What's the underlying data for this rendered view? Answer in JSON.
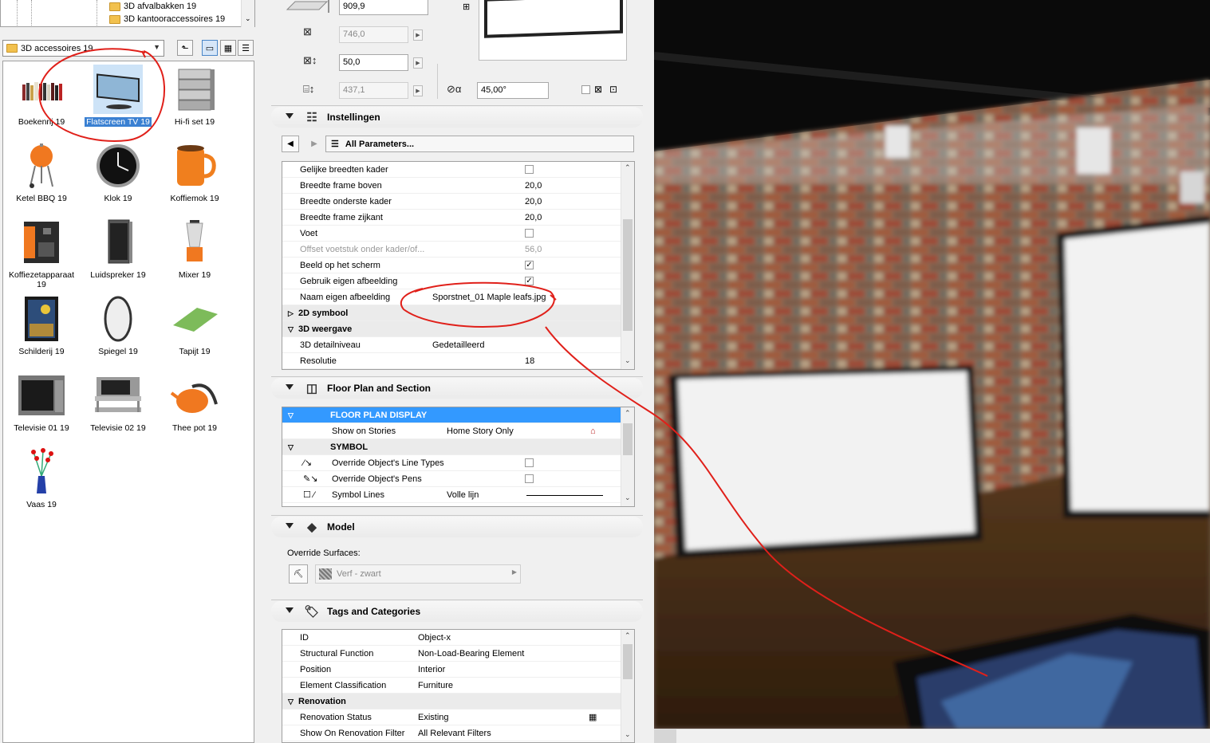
{
  "library": {
    "tree_items": [
      "3D afvalbakken 19",
      "3D kantooraccessoires 19"
    ],
    "current_library": "3D accessoires 19",
    "items": [
      {
        "label": "Boekenrij 19",
        "icon": "bookshelf-icon"
      },
      {
        "label": "Flatscreen TV 19",
        "icon": "flatscreen-tv-icon",
        "selected": true
      },
      {
        "label": "Hi-fi set 19",
        "icon": "hifi-set-icon"
      },
      {
        "label": "Ketel BBQ 19",
        "icon": "bbq-icon"
      },
      {
        "label": "Klok 19",
        "icon": "clock-icon"
      },
      {
        "label": "Koffiemok 19",
        "icon": "mug-icon"
      },
      {
        "label": "Koffiezetapparaat 19",
        "icon": "coffee-machine-icon"
      },
      {
        "label": "Luidspreker 19",
        "icon": "speaker-icon"
      },
      {
        "label": "Mixer 19",
        "icon": "blender-icon"
      },
      {
        "label": "Schilderij 19",
        "icon": "painting-icon"
      },
      {
        "label": "Spiegel 19",
        "icon": "mirror-icon"
      },
      {
        "label": "Tapijt 19",
        "icon": "rug-icon"
      },
      {
        "label": "Televisie 01 19",
        "icon": "crt-tv-icon"
      },
      {
        "label": "Televisie 02 19",
        "icon": "tv-stand-icon"
      },
      {
        "label": "Thee pot 19",
        "icon": "teapot-icon"
      },
      {
        "label": "Vaas 19",
        "icon": "vase-icon"
      }
    ]
  },
  "geometry_fields": {
    "height": "909,9",
    "width": "746,0",
    "depth": "50,0",
    "elevation": "437,1",
    "angle": "45,00°"
  },
  "instellingen": {
    "title": "Instellingen",
    "all_params_label": "All Parameters...",
    "rows": [
      {
        "name": "Gelijke breedten kader",
        "type": "check",
        "checked": false
      },
      {
        "name": "Breedte frame boven",
        "value": "20,0"
      },
      {
        "name": "Breedte onderste kader",
        "value": "20,0"
      },
      {
        "name": "Breedte frame zijkant",
        "value": "20,0"
      },
      {
        "name": "Voet",
        "type": "check",
        "checked": false
      },
      {
        "name": "Offset voetstuk onder kader/of...",
        "value": "56,0",
        "dim": true
      },
      {
        "name": "Beeld op het scherm",
        "type": "check",
        "checked": true
      },
      {
        "name": "Gebruik eigen afbeelding",
        "type": "check",
        "checked": true
      },
      {
        "name": "Naam eigen afbeelding",
        "value": "Sporstnet_01 Maple leafs.jpg",
        "wide": true
      },
      {
        "name": "2D symbool",
        "group": true,
        "open": false
      },
      {
        "name": "3D weergave",
        "group": true,
        "open": true
      },
      {
        "name": "3D detailniveau",
        "value": "Gedetailleerd",
        "wide": true
      },
      {
        "name": "Resolutie",
        "value": "18"
      }
    ]
  },
  "floor_plan": {
    "title": "Floor Plan and Section",
    "rows": [
      {
        "name": "FLOOR PLAN DISPLAY",
        "highlight": true
      },
      {
        "name": "Show on Stories",
        "value": "Home Story Only"
      },
      {
        "name": "SYMBOL",
        "group": true
      },
      {
        "name": "Override Object's Line Types",
        "type": "check"
      },
      {
        "name": "Override Object's Pens",
        "type": "check"
      },
      {
        "name": "Symbol Lines",
        "value": "Volle lijn"
      }
    ]
  },
  "model": {
    "title": "Model",
    "override_label": "Override Surfaces:",
    "surface": "Verf - zwart"
  },
  "tags": {
    "title": "Tags and Categories",
    "rows": [
      {
        "name": "ID",
        "value": "Object-x"
      },
      {
        "name": "Structural Function",
        "value": "Non-Load-Bearing Element"
      },
      {
        "name": "Position",
        "value": "Interior"
      },
      {
        "name": "Element Classification",
        "value": "Furniture"
      },
      {
        "name": "Renovation",
        "group": true
      },
      {
        "name": "Renovation Status",
        "value": "Existing"
      },
      {
        "name": "Show On Renovation Filter",
        "value": "All Relevant Filters"
      }
    ]
  },
  "colors": {
    "selection": "#3a80d2",
    "highlight_row": "#3399ff",
    "annotation": "#e0201a"
  }
}
